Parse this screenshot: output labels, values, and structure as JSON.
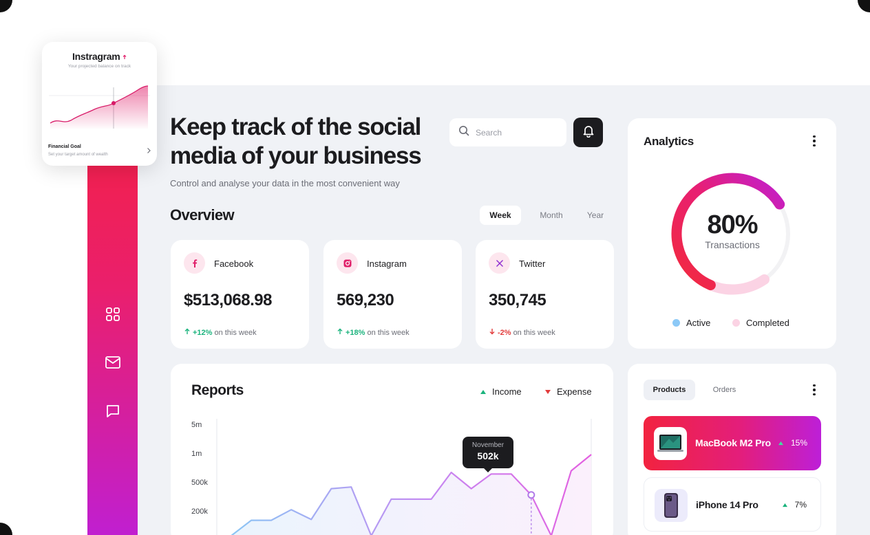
{
  "hero": {
    "title": "Keep track of the social media of your business",
    "subtitle": "Control and analyse your data in the most convenient way"
  },
  "search": {
    "placeholder": "Search"
  },
  "overview": {
    "title": "Overview",
    "periods": [
      "Week",
      "Month",
      "Year"
    ],
    "active_period": "Week",
    "stats": [
      {
        "name": "Facebook",
        "icon": "facebook-icon",
        "value": "$513,068.98",
        "change": "+12%",
        "direction": "up",
        "suffix": "on this week"
      },
      {
        "name": "Instagram",
        "icon": "instagram-icon",
        "value": "569,230",
        "change": "+18%",
        "direction": "up",
        "suffix": "on this week"
      },
      {
        "name": "Twitter",
        "icon": "x-icon",
        "value": "350,745",
        "change": "-2%",
        "direction": "down",
        "suffix": "on this week"
      }
    ]
  },
  "analytics": {
    "title": "Analytics",
    "percent": "80%",
    "label": "Transactions",
    "legend": [
      {
        "label": "Active",
        "color": "#8cc9f7"
      },
      {
        "label": "Completed",
        "color": "#fbd3e4"
      }
    ]
  },
  "reports": {
    "title": "Reports",
    "legend": [
      {
        "label": "Income",
        "color": "#1bb37d"
      },
      {
        "label": "Expense",
        "color": "#e23b3b"
      }
    ],
    "tooltip": {
      "month": "November",
      "value": "502k"
    }
  },
  "chart_data": {
    "type": "line",
    "y_tick_labels": [
      "5m",
      "1m",
      "500k",
      "200k"
    ],
    "series": [
      {
        "name": "Income",
        "values": [
          0,
          190,
          190,
          320,
          200,
          580,
          600,
          0,
          450,
          450,
          450,
          780,
          580,
          760,
          760,
          502,
          0,
          800,
          1000
        ]
      }
    ],
    "highlight": {
      "label": "November",
      "value": "502k"
    },
    "colors": [
      "#8cc6f4",
      "#c58af2",
      "#e35fe0"
    ]
  },
  "products": {
    "tabs": [
      "Products",
      "Orders"
    ],
    "active_tab": "Products",
    "items": [
      {
        "name": "MacBook M2 Pro",
        "percent": "15%",
        "trend": "up",
        "highlighted": true
      },
      {
        "name": "iPhone 14 Pro",
        "percent": "7%",
        "trend": "up",
        "highlighted": false
      }
    ]
  },
  "instagram_card": {
    "title": "Instragram",
    "subtitle": "Your projected balance on track",
    "goal_title": "Financial Goal",
    "goal_subtitle": "Set your target amount of wealth"
  },
  "colors": {
    "accent_red": "#f5213f",
    "accent_purple": "#c01fd0",
    "background": "#f0f2f6"
  }
}
